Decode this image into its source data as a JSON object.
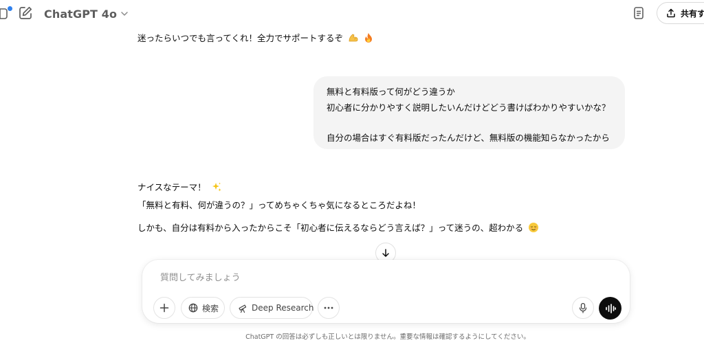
{
  "header": {
    "model_name": "ChatGPT 4o",
    "share_label": "共有する"
  },
  "conversation": {
    "prev_assistant_line": "迷ったらいつでも言ってくれ！全力でサポートするぞ",
    "user_message_lines": [
      "無料と有料版って何がどう違うか",
      "初心者に分かりやすく説明したいんだけどどう書けばわかりやすいかな？",
      "",
      "自分の場合はすぐ有料版だったんだけど、無料版の機能知らなかったから"
    ],
    "assistant_lines": [
      "ナイスなテーマ！",
      "「無料と有料、何が違うの？」ってめちゃくちゃ気になるところだよね！",
      "しかも、自分は有料から入ったからこそ「初心者に伝えるならどう言えば？」って迷うの、超わかる"
    ],
    "emojis": [
      "flexed-biceps-emoji",
      "fire-emoji",
      "sparkles-emoji",
      "relieved-face-emoji"
    ]
  },
  "composer": {
    "placeholder": "質問してみましょう",
    "value": "",
    "tools": {
      "search_label": "検索",
      "deep_research_label": "Deep Research"
    }
  },
  "footer": {
    "disclaimer": "ChatGPT の回答は必ずしも正しいとは限りません。重要な情報は確認するようにしてください。"
  },
  "colors": {
    "accent_dot": "#2f80ed",
    "user_bubble": "#f4f4f4",
    "voice_button": "#0d0d0d"
  }
}
